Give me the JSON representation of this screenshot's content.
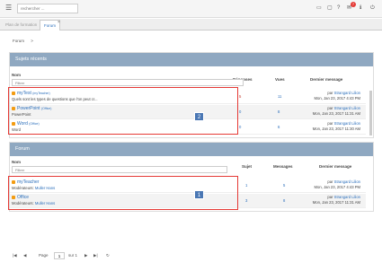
{
  "topbar": {
    "search_placeholder": "rechercher ...",
    "notification_count": "7"
  },
  "tabs": [
    {
      "label": "Plan de formation"
    },
    {
      "label": "Forum"
    }
  ],
  "breadcrumb": {
    "label": "Forum",
    "sep": ">"
  },
  "recent": {
    "title": "Sujets récents",
    "col_name": "Nom",
    "col_replies": "Réponses",
    "col_views": "Vues",
    "col_last": "Dernier message",
    "filter_placeholder": "Filtrer",
    "marker": "2",
    "rows": [
      {
        "title": "myTest",
        "tag": "(myTeacher)",
        "sub": "Quels sont les types de questions que l'on peut cr...",
        "replies": "5",
        "views": "11",
        "by_prefix": "par",
        "by": "Strangard Lilion",
        "date": "Mon, Jan 23, 2017 4:43 PM"
      },
      {
        "title": "PowerPoint",
        "tag": "(Office)",
        "sub": "PowerPoint",
        "replies": "0",
        "views": "8",
        "by_prefix": "par",
        "by": "Strangard Lilion",
        "date": "Mon, Jan 23, 2017 11:31 AM"
      },
      {
        "title": "Word",
        "tag": "(Office)",
        "sub": "Word",
        "replies": "0",
        "views": "6",
        "by_prefix": "par",
        "by": "Strangard Lilion",
        "date": "Mon, Jan 23, 2017 11:30 AM"
      }
    ]
  },
  "forum": {
    "title": "Forum",
    "col_name": "Nom",
    "col_subject": "Sujet",
    "col_messages": "Messages",
    "col_last": "Dernier message",
    "filter_placeholder": "Filtrer",
    "marker": "1",
    "mod_label": "Modérateurs:",
    "rows": [
      {
        "title": "myTeacher",
        "moderators": "Muller Hans",
        "subjects": "1",
        "messages": "5",
        "by_prefix": "par",
        "by": "Strangard Lilion",
        "date": "Mon, Jan 23, 2017 4:43 PM"
      },
      {
        "title": "Office",
        "moderators": "Muller Hans",
        "subjects": "3",
        "messages": "8",
        "by_prefix": "par",
        "by": "Strangard Lilion",
        "date": "Mon, Jan 23, 2017 11:31 AM"
      }
    ]
  },
  "pager": {
    "first": "|◀",
    "prev": "◀",
    "page_label": "Page",
    "page_value": "1",
    "of_label": "sur 1",
    "next": "▶",
    "last": "▶|",
    "refresh": "↻"
  },
  "colors": {
    "header": "#8fa8c1",
    "link": "#2a6ebb",
    "highlight": "#e53935",
    "marker": "#4a77b4"
  }
}
